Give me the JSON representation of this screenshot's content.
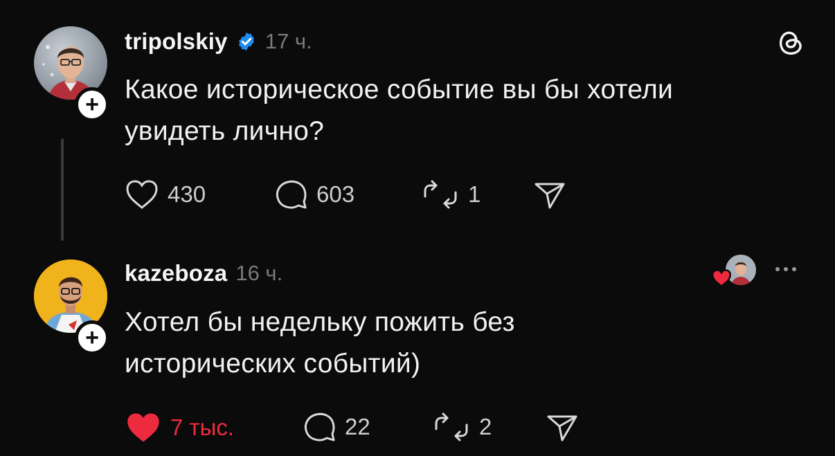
{
  "posts": [
    {
      "username": "tripolskiy",
      "verified": true,
      "time": "17 ч.",
      "text_lines": [
        "Какое историческое событие вы бы хотели",
        "увидеть лично?"
      ],
      "likes": "430",
      "comments": "603",
      "reposts": "1",
      "liked": false
    },
    {
      "username": "kazeboza",
      "verified": false,
      "time": "16 ч.",
      "text_lines": [
        "Хотел бы недельку пожить без",
        "исторических событий)"
      ],
      "likes": "7 тыс.",
      "comments": "22",
      "reposts": "2",
      "liked": true
    }
  ],
  "icons": {
    "app": "threads-logo-icon",
    "verified": "verified-badge-icon",
    "like": "heart-icon",
    "comment": "comment-icon",
    "repost": "repost-icon",
    "share": "send-icon",
    "more": "more-options-icon",
    "follow": "plus-icon"
  },
  "colors": {
    "background": "#0b0b0b",
    "verified": "#1d8cf0",
    "liked": "#ee2b3e",
    "secondary_text": "#7a7a7a"
  }
}
